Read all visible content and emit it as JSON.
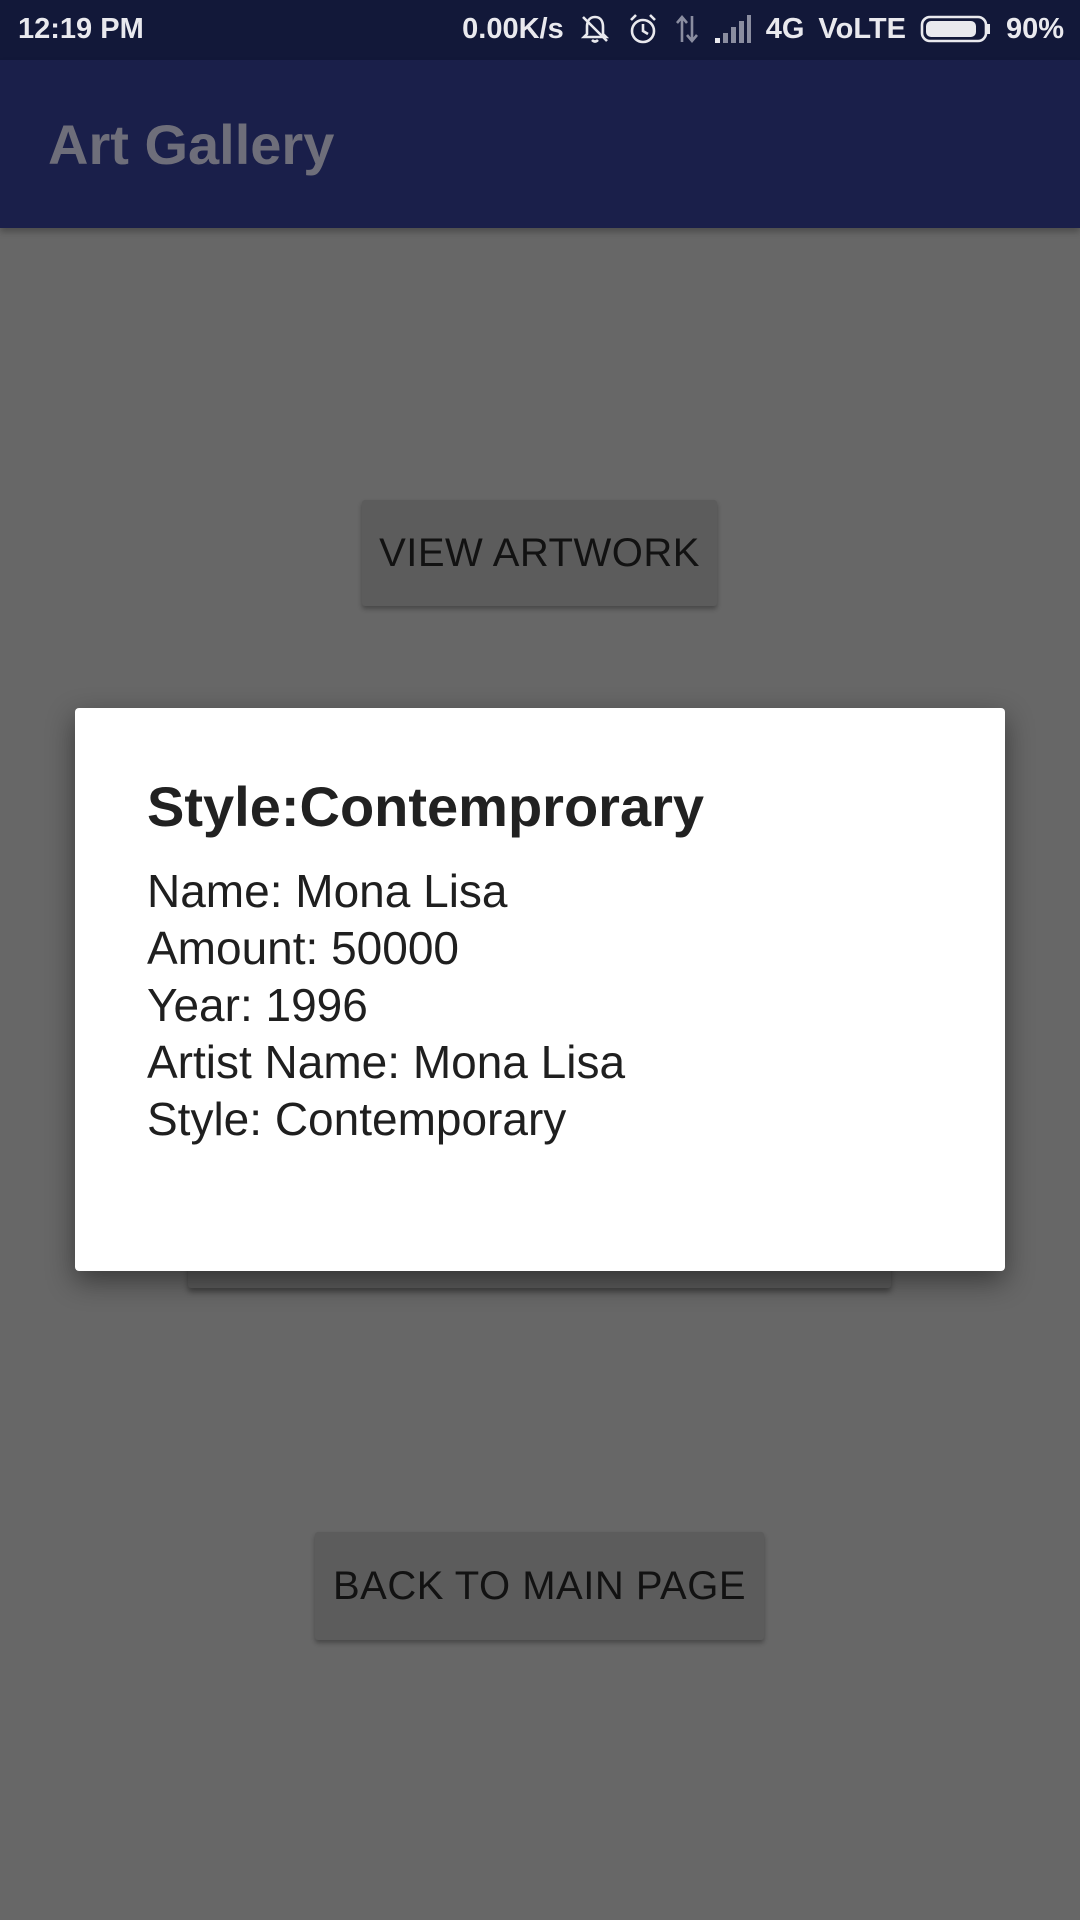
{
  "status_bar": {
    "time": "12:19 PM",
    "net_speed": "0.00K/s",
    "network": "4G",
    "volte": "VoLTE",
    "battery_percent": "90%",
    "battery_level": 0.9,
    "icons": [
      "mute-bell-icon",
      "alarm-icon",
      "data-arrows-icon",
      "signal-icon",
      "battery-icon"
    ]
  },
  "app_bar": {
    "title": "Art Gallery"
  },
  "buttons": {
    "view_artwork": "VIEW ARTWORK",
    "back_to_main": "BACK TO MAIN PAGE"
  },
  "dialog": {
    "title": "Style:Contemprorary",
    "lines": [
      "Name: Mona Lisa",
      "Amount: 50000",
      "Year: 1996",
      "Artist Name: Mona Lisa",
      "Style: Contemporary"
    ]
  },
  "colors": {
    "status_bar": "#121839",
    "app_bar": "#1a1f4a",
    "scrim_background": "#676767",
    "dialog_background": "#ffffff"
  }
}
